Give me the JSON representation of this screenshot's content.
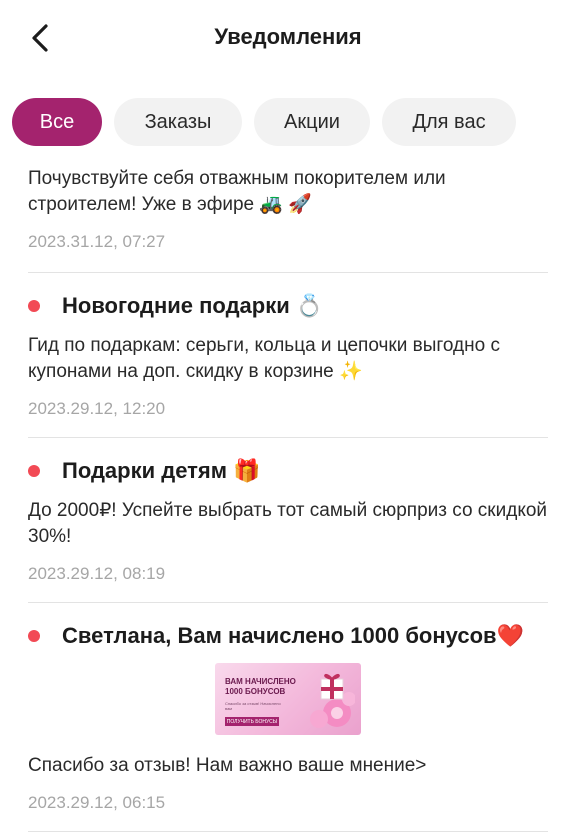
{
  "header": {
    "title": "Уведомления"
  },
  "tabs": [
    {
      "label": "Все",
      "active": true
    },
    {
      "label": "Заказы",
      "active": false
    },
    {
      "label": "Акции",
      "active": false
    },
    {
      "label": "Для вас",
      "active": false
    }
  ],
  "notifications": [
    {
      "title": "",
      "body": "Почувствуйте себя отважным покорителем или строителем! Уже в эфире 🚜 🚀",
      "date": "2023.31.12, 07:27",
      "unread": false
    },
    {
      "title": "Новогодние подарки 💍",
      "body": "Гид по подаркам: серьги, кольца и цепочки выгодно с купонами на доп. скидку в корзине ✨",
      "date": "2023.29.12, 12:20",
      "unread": true
    },
    {
      "title": "Подарки детям 🎁",
      "body": "До 2000₽! Успейте выбрать тот самый сюрприз со скидкой 30%!",
      "date": "2023.29.12, 08:19",
      "unread": true
    },
    {
      "title": "Светлана, Вам начислено 1000 бонусов❤️",
      "body": "Спасибо за отзыв! Нам важно ваше мнение>",
      "date": "2023.29.12, 06:15",
      "unread": true,
      "banner": {
        "headline": "ВАМ НАЧИСЛЕНО 1000 БОНУСОВ",
        "subtext": "Спасибо за отзыв! Начислено вам",
        "button": "ПОЛУЧИТЬ БОНУСЫ"
      }
    }
  ],
  "colors": {
    "accent": "#a4236e",
    "unread_dot": "#f24a55",
    "date": "#a6a6a6",
    "divider": "#e3e3e3"
  }
}
